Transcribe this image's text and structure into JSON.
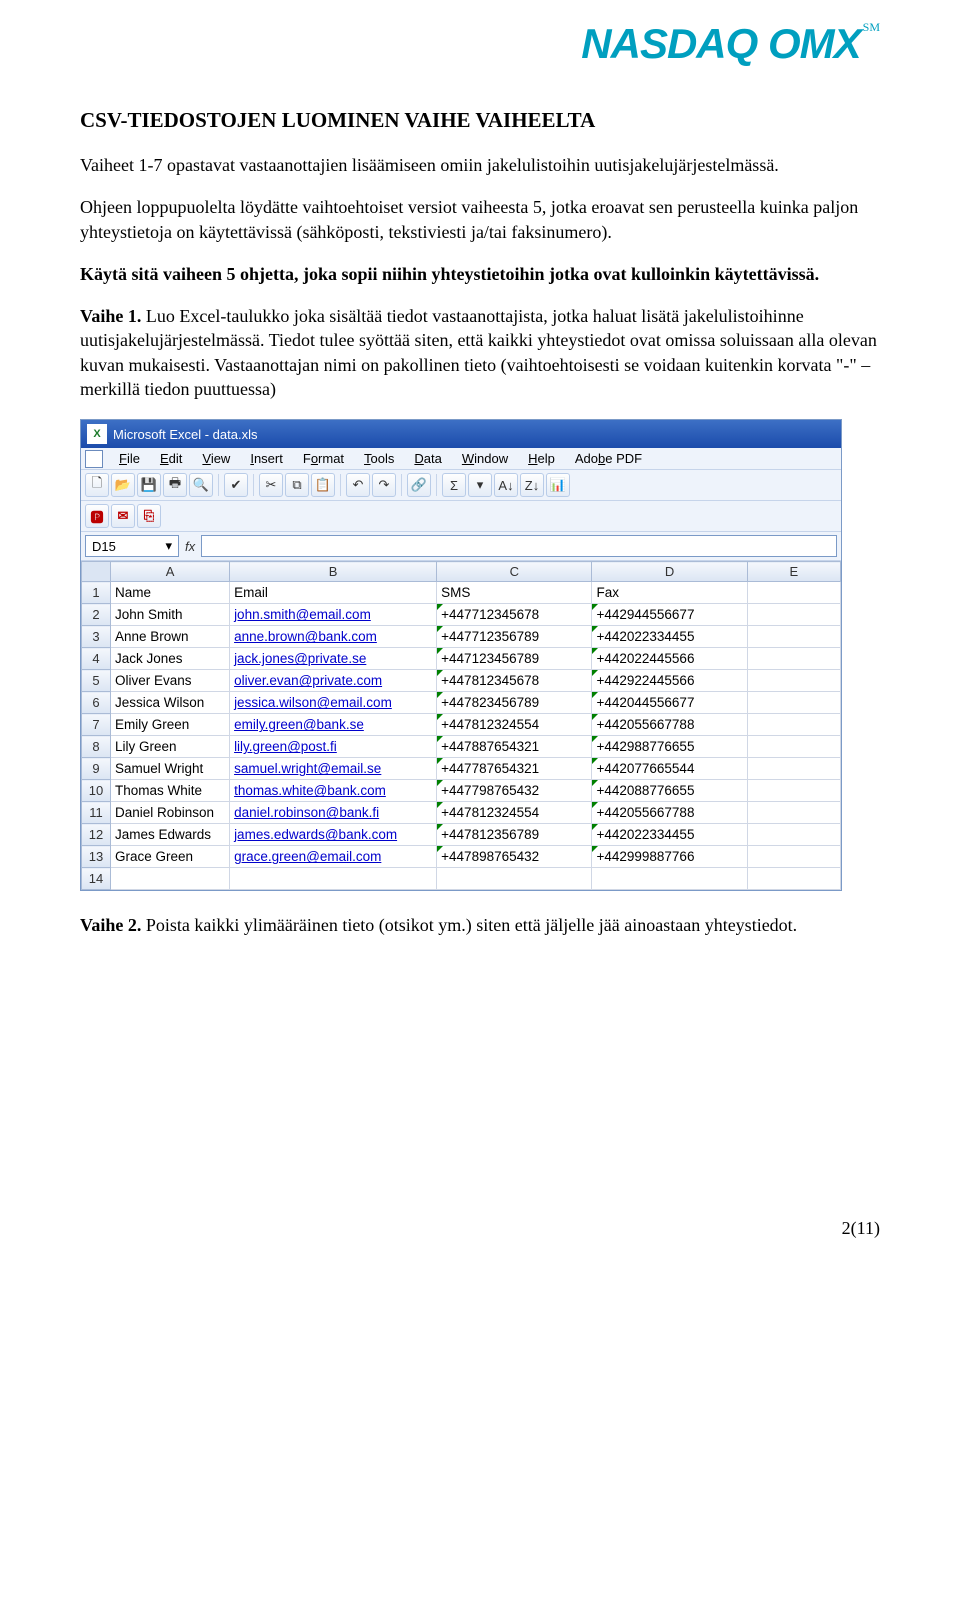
{
  "brand": "NASDAQ OMX",
  "brand_sm": "SM",
  "heading": "CSV-TIEDOSTOJEN LUOMINEN VAIHE VAIHEELTA",
  "para1": "Vaiheet 1-7 opastavat vastaanottajien lisäämiseen omiin jakelulistoihin uutisjakelujärjestelmässä.",
  "para2": "Ohjeen loppupuolelta löydätte vaihtoehtoiset versiot vaiheesta 5, jotka eroavat sen perusteella kuinka paljon yhteystietoja on käytettävissä (sähköposti, tekstiviesti ja/tai faksinumero).",
  "para3": "Käytä sitä vaiheen 5 ohjetta, joka sopii niihin yhteystietoihin jotka ovat kulloinkin käytettävissä.",
  "vaihe1_label": "Vaihe 1.",
  "vaihe1_text": " Luo Excel-taulukko joka sisältää tiedot vastaanottajista, jotka haluat lisätä jakelulistoihinne uutisjakelujärjestelmässä. Tiedot tulee syöttää siten, että kaikki yhteystiedot ovat omissa soluissaan alla olevan kuvan mukaisesti. Vastaanottajan nimi on pakollinen tieto (vaihtoehtoisesti se voidaan kuitenkin korvata \"-\" –merkillä tiedon puuttuessa)",
  "excel": {
    "title": "Microsoft Excel - data.xls",
    "menus": [
      "File",
      "Edit",
      "View",
      "Insert",
      "Format",
      "Tools",
      "Data",
      "Window",
      "Help",
      "Adobe PDF"
    ],
    "namebox": "D15",
    "columns": [
      "A",
      "B",
      "C",
      "D",
      "E"
    ],
    "headers": [
      "Name",
      "Email",
      "SMS",
      "Fax"
    ],
    "rows": [
      [
        "John Smith",
        "john.smith@email.com",
        "+447712345678",
        "+442944556677"
      ],
      [
        "Anne Brown",
        "anne.brown@bank.com",
        "+447712356789",
        "+442022334455"
      ],
      [
        "Jack Jones",
        "jack.jones@private.se",
        "+447123456789",
        "+442022445566"
      ],
      [
        "Oliver Evans",
        "oliver.evan@private.com",
        "+447812345678",
        "+442922445566"
      ],
      [
        "Jessica Wilson",
        "jessica.wilson@email.com",
        "+447823456789",
        "+442044556677"
      ],
      [
        "Emily Green",
        "emily.green@bank.se",
        "+447812324554",
        "+442055667788"
      ],
      [
        "Lily Green",
        "lily.green@post.fi",
        "+447887654321",
        "+442988776655"
      ],
      [
        "Samuel Wright",
        "samuel.wright@email.se",
        "+447787654321",
        "+442077665544"
      ],
      [
        "Thomas White",
        "thomas.white@bank.com",
        "+447798765432",
        "+442088776655"
      ],
      [
        "Daniel Robinson",
        "daniel.robinson@bank.fi",
        "+447812324554",
        "+442055667788"
      ],
      [
        "James Edwards",
        "james.edwards@bank.com",
        "+447812356789",
        "+442022334455"
      ],
      [
        "Grace Green",
        "grace.green@email.com",
        "+447898765432",
        "+442999887766"
      ]
    ]
  },
  "vaihe2_label": "Vaihe 2.",
  "vaihe2_text": " Poista kaikki ylimääräinen tieto (otsikot ym.) siten että jäljelle jää ainoastaan yhteystiedot.",
  "pagenum": "2(11)",
  "icons": {
    "new": "🗋",
    "open": "📂",
    "save": "💾",
    "print": "🖶",
    "preview": "🔍",
    "spell": "✔",
    "cut": "✂",
    "copy": "⧉",
    "paste": "📋",
    "undo": "↶",
    "redo": "↷",
    "link": "🔗",
    "sum": "Σ",
    "asc": "A↓",
    "desc": "Z↓",
    "chart": "📊",
    "dropdown": "▾"
  }
}
